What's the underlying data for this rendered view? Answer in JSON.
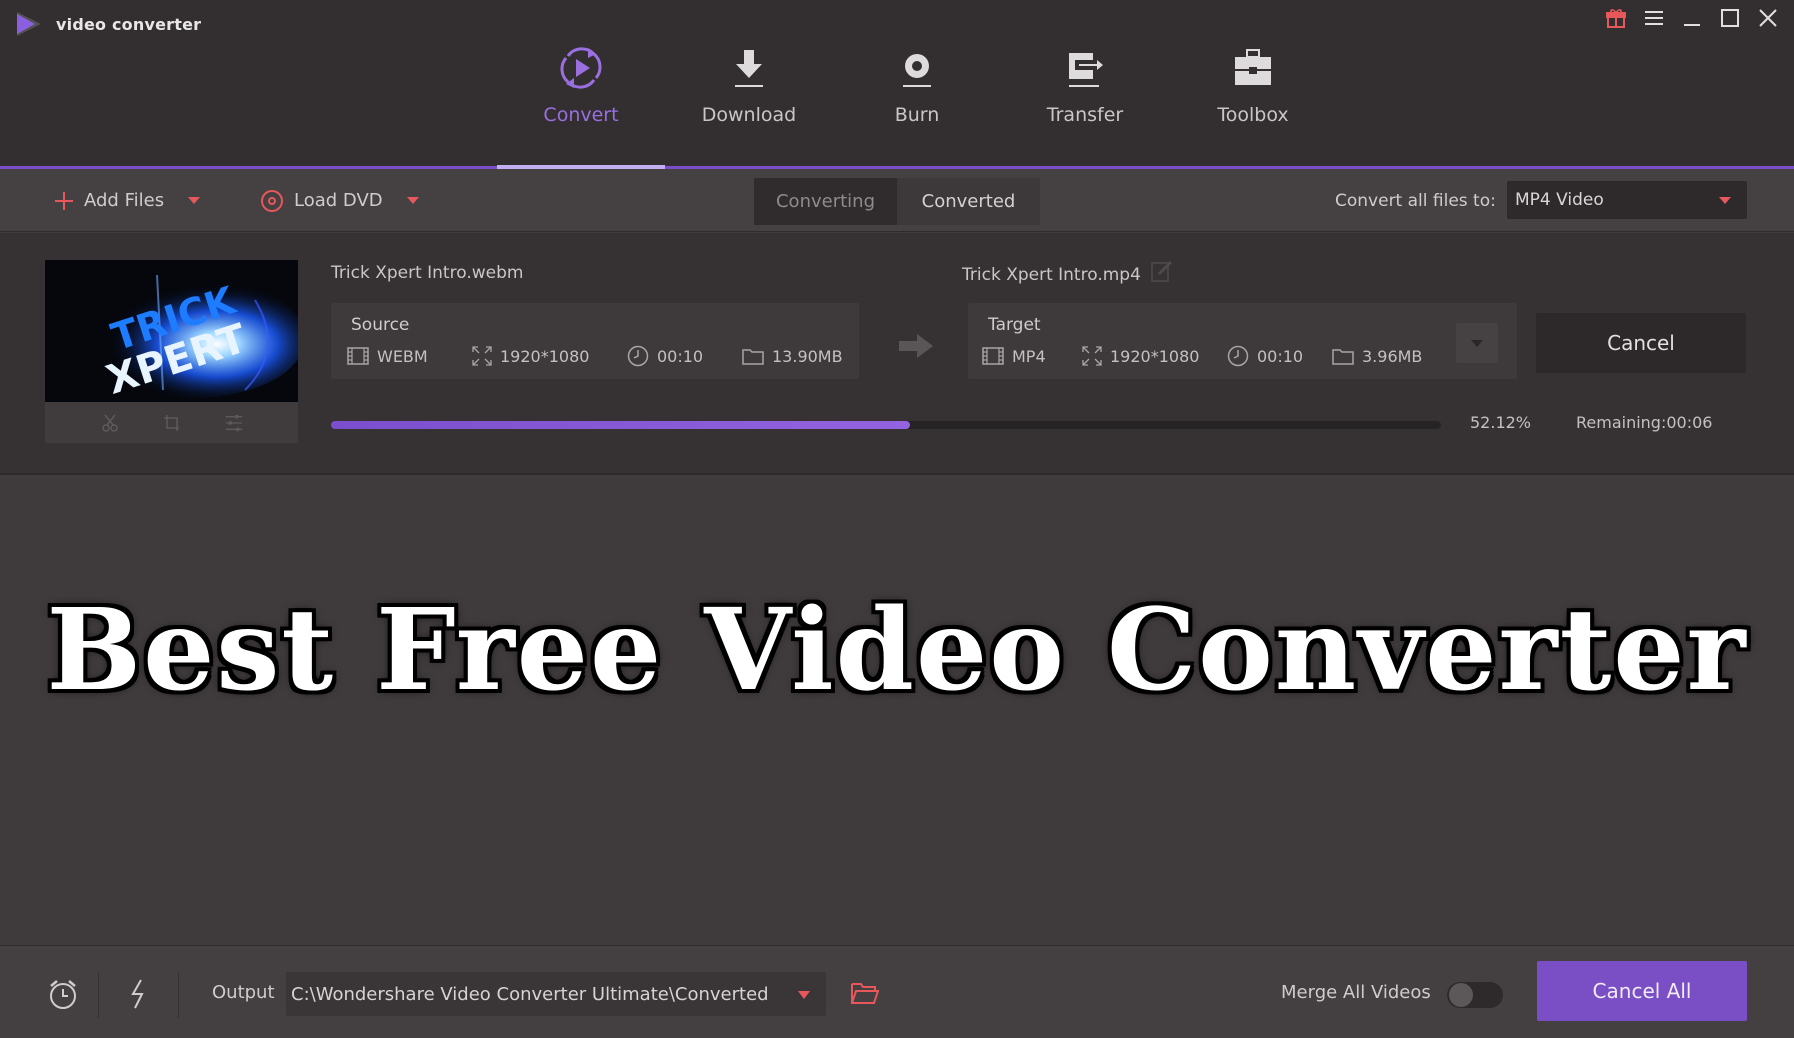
{
  "app": {
    "title": "video converter",
    "accent_color": "#7b4fc9",
    "alert_color": "#e8575a"
  },
  "window_controls": [
    "gift-icon",
    "menu-icon",
    "minimize-icon",
    "maximize-icon",
    "close-icon"
  ],
  "nav": {
    "active": "Convert",
    "items": [
      {
        "label": "Convert",
        "icon": "convert-icon"
      },
      {
        "label": "Download",
        "icon": "download-icon"
      },
      {
        "label": "Burn",
        "icon": "burn-icon"
      },
      {
        "label": "Transfer",
        "icon": "transfer-icon"
      },
      {
        "label": "Toolbox",
        "icon": "toolbox-icon"
      }
    ]
  },
  "toolbar": {
    "add_files": "Add Files",
    "load_dvd": "Load DVD",
    "tabs": {
      "converting": "Converting",
      "converted": "Converted",
      "active": "Converting"
    },
    "convert_all_label": "Convert all files to:",
    "convert_all_value": "MP4 Video"
  },
  "file": {
    "thumbnail_text": "TRICK XPERT",
    "source_name": "Trick Xpert Intro.webm",
    "target_name": "Trick Xpert Intro.mp4",
    "source": {
      "title": "Source",
      "format": "WEBM",
      "resolution": "1920*1080",
      "duration": "00:10",
      "size": "13.90MB"
    },
    "target": {
      "title": "Target",
      "format": "MP4",
      "resolution": "1920*1080",
      "duration": "00:10",
      "size": "3.96MB"
    },
    "cancel_label": "Cancel",
    "progress_percent": 52.12,
    "progress_text": "52.12%",
    "remaining_text": "Remaining:00:06"
  },
  "headline": "Best Free Video Converter",
  "bottom": {
    "output_label": "Output",
    "output_path": "C:\\Wondershare Video Converter Ultimate\\Converted",
    "merge_label": "Merge All Videos",
    "merge_enabled": false,
    "cancel_all_label": "Cancel All"
  }
}
